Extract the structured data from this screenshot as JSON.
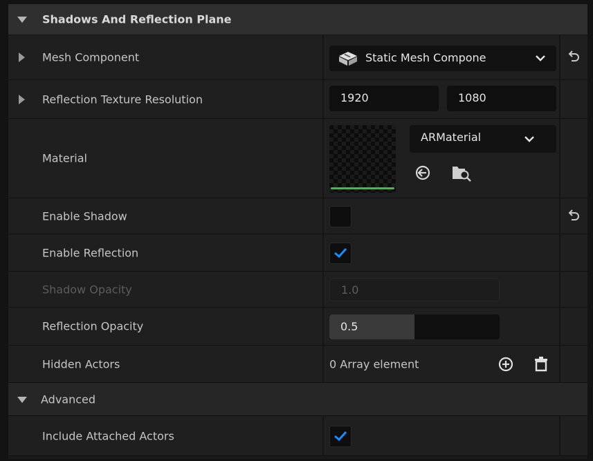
{
  "section": {
    "title": "Shadows And Reflection Plane"
  },
  "properties": {
    "mesh_component": {
      "label": "Mesh Component",
      "value": "Static Mesh Compone"
    },
    "reflection_texture_resolution": {
      "label": "Reflection Texture Resolution",
      "width": "1920",
      "height": "1080"
    },
    "material": {
      "label": "Material",
      "value": "ARMaterial"
    },
    "enable_shadow": {
      "label": "Enable Shadow",
      "checked": false
    },
    "enable_reflection": {
      "label": "Enable Reflection",
      "checked": true
    },
    "shadow_opacity": {
      "label": "Shadow Opacity",
      "value": "1.0",
      "enabled": false
    },
    "reflection_opacity": {
      "label": "Reflection Opacity",
      "value": "0.5",
      "fill_fraction": 0.5
    },
    "hidden_actors": {
      "label": "Hidden Actors",
      "value": "0 Array element"
    }
  },
  "advanced": {
    "title": "Advanced",
    "include_attached_actors": {
      "label": "Include Attached Actors",
      "checked": true
    }
  },
  "colors": {
    "checkmark": "#1a8cff",
    "thumbnail_underline": "#3fbf3f",
    "field_bg": "#0f0f0f",
    "header_bg": "#2f2f2f"
  }
}
